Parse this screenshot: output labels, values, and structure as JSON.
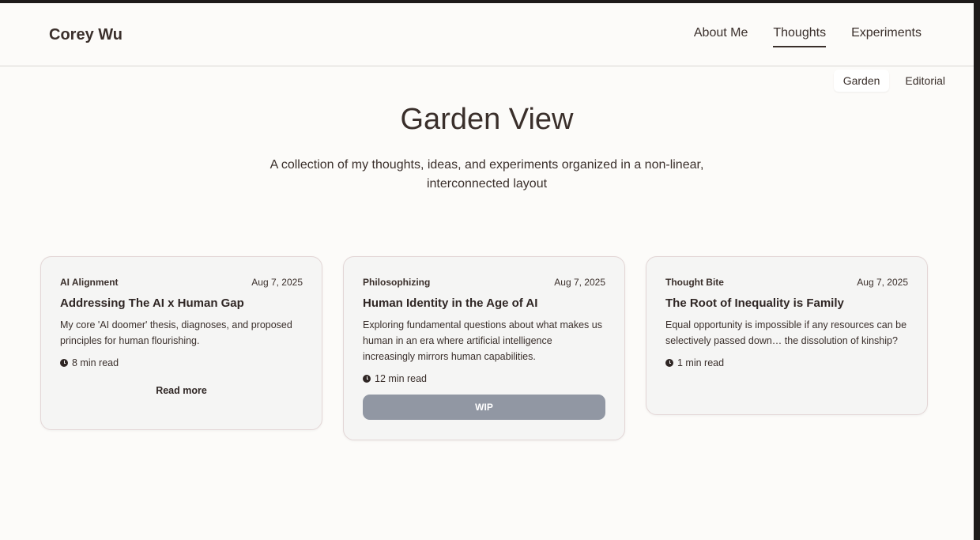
{
  "header": {
    "brand": "Corey Wu",
    "nav": [
      {
        "label": "About Me",
        "active": false
      },
      {
        "label": "Thoughts",
        "active": true
      },
      {
        "label": "Experiments",
        "active": false
      }
    ]
  },
  "view_toggle": {
    "options": [
      {
        "label": "Garden",
        "active": true
      },
      {
        "label": "Editorial",
        "active": false
      }
    ]
  },
  "main": {
    "title": "Garden View",
    "subtitle": "A collection of my thoughts, ideas, and experiments organized in a non-linear, interconnected layout"
  },
  "cards": [
    {
      "category": "AI Alignment",
      "date": "Aug 7, 2025",
      "title": "Addressing The AI x Human Gap",
      "description": "My core 'AI doomer' thesis, diagnoses, and proposed principles for human flourishing.",
      "read_time": "8 min read",
      "action": "Read more"
    },
    {
      "category": "Philosophizing",
      "date": "Aug 7, 2025",
      "title": "Human Identity in the Age of AI",
      "description": "Exploring fundamental questions about what makes us human in an era where artificial intelligence increasingly mirrors human capabilities.",
      "read_time": "12 min read",
      "action": "WIP"
    },
    {
      "category": "Thought Bite",
      "date": "Aug 7, 2025",
      "title": "The Root of Inequality is Family",
      "description": "Equal opportunity is impossible if any resources can be selectively passed down… the dissolution of kinship?",
      "read_time": "1 min read"
    }
  ],
  "icons": {
    "read_time": "clock-icon"
  },
  "colors": {
    "background": "#fcfbf9",
    "text": "#3a2f2b",
    "card": "#f5f5f4",
    "wip_button": "#9197a3"
  }
}
